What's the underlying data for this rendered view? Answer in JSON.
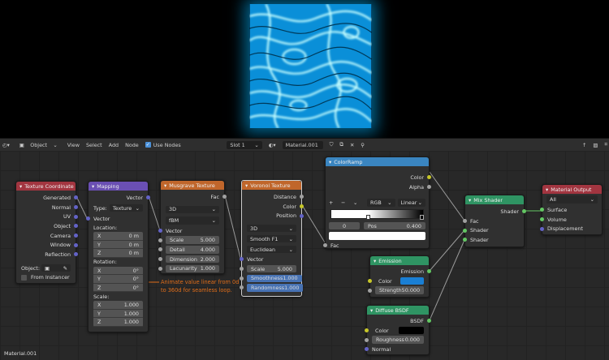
{
  "header": {
    "editor_type": "Object",
    "menus": [
      "View",
      "Select",
      "Add",
      "Node"
    ],
    "use_nodes": "Use Nodes",
    "slot": "Slot 1",
    "material": "Material.001"
  },
  "nodes": {
    "texcoord": {
      "title": "Texture Coordinate",
      "outputs": [
        "Generated",
        "Normal",
        "UV",
        "Object",
        "Camera",
        "Window",
        "Reflection"
      ],
      "object_label": "Object:",
      "from_instancer": "From Instancer"
    },
    "mapping": {
      "title": "Mapping",
      "output": "Vector",
      "type_label": "Type:",
      "type_value": "Texture",
      "input": "Vector",
      "location": "Location:",
      "loc": [
        [
          "X",
          "0 m"
        ],
        [
          "Y",
          "0 m"
        ],
        [
          "Z",
          "0 m"
        ]
      ],
      "rotation": "Rotation:",
      "rot": [
        [
          "X",
          "0°"
        ],
        [
          "Y",
          "0°"
        ],
        [
          "Z",
          "0°"
        ]
      ],
      "scale": "Scale:",
      "scl": [
        [
          "X",
          "1.000"
        ],
        [
          "Y",
          "1.000"
        ],
        [
          "Z",
          "1.000"
        ]
      ]
    },
    "musgrave": {
      "title": "Musgrave Texture",
      "output": "Fac",
      "dim": "3D",
      "type": "fBM",
      "input": "Vector",
      "fields": [
        [
          "Scale",
          "5.000"
        ],
        [
          "Detail",
          "4.000"
        ],
        [
          "Dimension",
          "2.000"
        ],
        [
          "Lacunarity",
          "1.000"
        ]
      ]
    },
    "voronoi": {
      "title": "Voronoi Texture",
      "outputs": [
        "Distance",
        "Color",
        "Position"
      ],
      "dim": "3D",
      "feature": "Smooth F1",
      "metric": "Euclidean",
      "input": "Vector",
      "fields": [
        [
          "Scale",
          "5.000"
        ],
        [
          "Smoothness",
          "1.000"
        ],
        [
          "Randomness",
          "1.000"
        ]
      ]
    },
    "colorramp": {
      "title": "ColorRamp",
      "outputs": [
        "Color",
        "Alpha"
      ],
      "color_mode": "RGB",
      "interp": "Linear",
      "index": "0",
      "pos_label": "Pos",
      "pos": "0.400",
      "input": "Fac"
    },
    "mix": {
      "title": "Mix Shader",
      "output": "Shader",
      "inputs": [
        "Fac",
        "Shader",
        "Shader"
      ]
    },
    "output": {
      "title": "Material Output",
      "target": "All",
      "inputs": [
        "Surface",
        "Volume",
        "Displacement"
      ]
    },
    "emission": {
      "title": "Emission",
      "output": "Emission",
      "color_label": "Color",
      "color": "#1a7fd4",
      "strength_label": "Strength",
      "strength": "50.000"
    },
    "diffuse": {
      "title": "Diffuse BSDF",
      "output": "BSDF",
      "color_label": "Color",
      "color": "#000000",
      "rough_label": "Roughness",
      "rough": "0.000",
      "normal": "Normal"
    }
  },
  "annotation": "Animate value linear from 0d to 360d for seamless loop.",
  "footer": "Material.001"
}
